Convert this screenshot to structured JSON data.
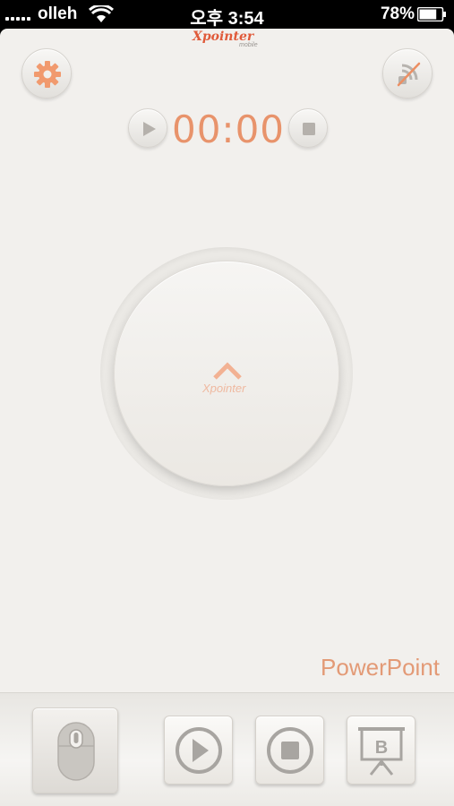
{
  "status_bar": {
    "carrier": "olleh",
    "time": "오후 3:54",
    "battery_percent": "78%",
    "battery_level": 0.78
  },
  "header": {
    "logo_text": "Xpointer",
    "logo_subtext": "mobile"
  },
  "icons": {
    "settings": "gear-icon",
    "wireless": "wireless-disconnected-icon",
    "timer_play": "play-icon",
    "timer_stop": "stop-icon",
    "touchpad_arrow": "chevron-up-icon",
    "mouse": "mouse-icon",
    "slideshow_play": "play-circle-icon",
    "slideshow_stop": "stop-circle-icon",
    "black_screen": "presentation-board-icon"
  },
  "timer": {
    "display": "00:00"
  },
  "touchpad": {
    "logo_text": "Xpointer"
  },
  "mode": {
    "label": "PowerPoint"
  },
  "toolbar": {
    "black_screen_letter": "B"
  },
  "colors": {
    "accent": "#e8936b",
    "background": "#f2f0ed",
    "icon_gray": "#8f8c88"
  }
}
